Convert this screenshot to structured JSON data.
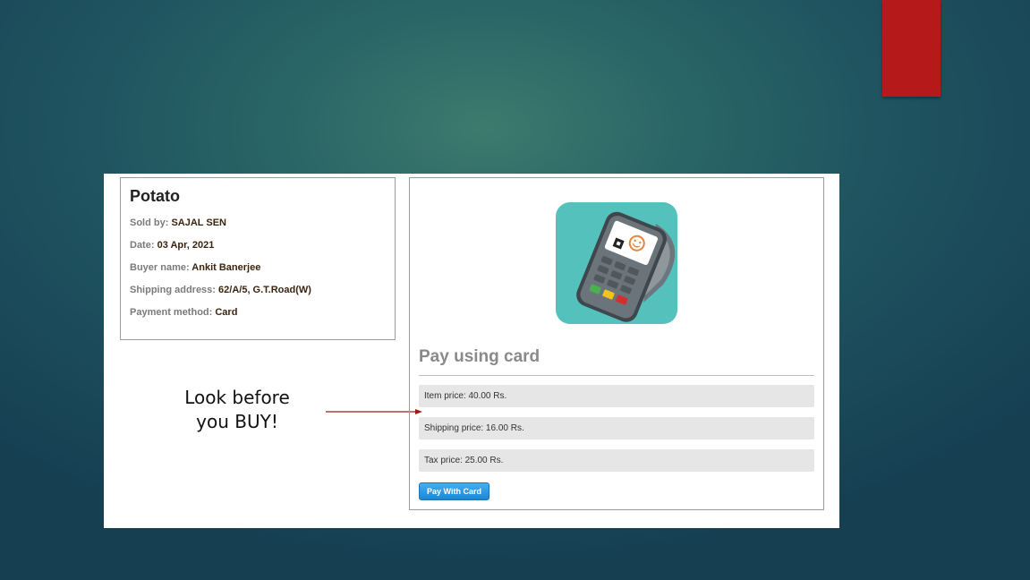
{
  "product": {
    "title": "Potato",
    "rows": [
      {
        "label": "Sold by:",
        "value": "SAJAL SEN"
      },
      {
        "label": "Date:",
        "value": "03 Apr, 2021"
      },
      {
        "label": "Buyer name:",
        "value": "Ankit Banerjee"
      },
      {
        "label": "Shipping address:",
        "value": "62/A/5, G.T.Road(W)"
      },
      {
        "label": "Payment method:",
        "value": "Card"
      }
    ]
  },
  "annotation": {
    "line1": "Look before",
    "line2": "you BUY!"
  },
  "payment": {
    "heading": "Pay using card",
    "prices": [
      "Item price: 40.00 Rs.",
      "Shipping price: 16.00 Rs.",
      "Tax price: 25.00 Rs."
    ],
    "button_label": "Pay With Card"
  },
  "icons": {
    "terminal": "card-terminal-icon"
  },
  "colors": {
    "accent_red": "#b5191a",
    "button_blue": "#1a87d6",
    "terminal_bg": "#54c1bc"
  }
}
